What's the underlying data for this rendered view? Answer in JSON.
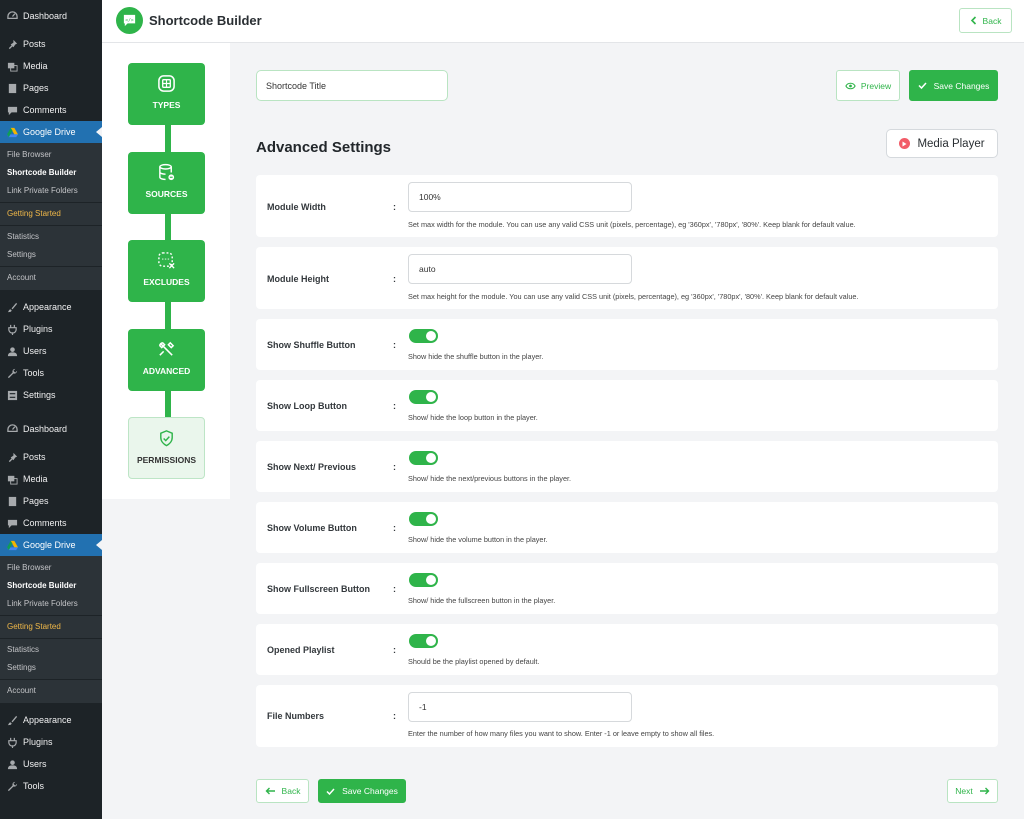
{
  "sidebar": {
    "groups": [
      {
        "items": [
          {
            "label": "Dashboard",
            "icon": "dashboard-icon"
          },
          {
            "label": "Posts",
            "icon": "pin-icon"
          },
          {
            "label": "Media",
            "icon": "media-icon"
          },
          {
            "label": "Pages",
            "icon": "pages-icon"
          },
          {
            "label": "Comments",
            "icon": "comments-icon"
          },
          {
            "label": "Google Drive",
            "icon": "google-drive-icon",
            "active": true
          }
        ],
        "submenu": [
          "File Browser",
          "Shortcode Builder",
          "Link Private Folders",
          "Getting Started",
          "Statistics",
          "Settings",
          "Account"
        ],
        "after": [
          "Appearance",
          "Plugins",
          "Users",
          "Tools",
          "Settings"
        ]
      },
      {
        "items": [
          {
            "label": "Dashboard"
          },
          {
            "label": "Posts"
          },
          {
            "label": "Media"
          },
          {
            "label": "Pages"
          },
          {
            "label": "Comments"
          },
          {
            "label": "Google Drive"
          }
        ],
        "submenu": [
          "File Browser",
          "Shortcode Builder",
          "Link Private Folders",
          "Getting Started",
          "Statistics",
          "Settings",
          "Account"
        ],
        "after": [
          "Appearance",
          "Plugins",
          "Users",
          "Tools"
        ]
      }
    ]
  },
  "header": {
    "title": "Shortcode Builder",
    "back_label": "Back"
  },
  "steps": [
    {
      "label": "TYPES",
      "icon": "grid-plus-icon",
      "state": "complete"
    },
    {
      "label": "SOURCES",
      "icon": "database-icon",
      "state": "complete"
    },
    {
      "label": "EXCLUDES",
      "icon": "exclude-icon",
      "state": "complete"
    },
    {
      "label": "ADVANCED",
      "icon": "tools-icon",
      "state": "active"
    },
    {
      "label": "PERMISSIONS",
      "icon": "shield-check-icon",
      "state": "pending"
    }
  ],
  "main": {
    "title_input_value": "Shortcode Title",
    "preview_label": "Preview",
    "save_label": "Save Changes",
    "section_title": "Advanced Settings",
    "type_badge": "Media Player",
    "settings": [
      {
        "label": "Module Width",
        "value": "100%",
        "desc": "Set max width for the module. You can use any valid CSS unit (pixels, percentage), eg '360px', '780px', '80%'. Keep blank for default value."
      },
      {
        "label": "Module Height",
        "value": "auto",
        "desc": "Set max height for the module. You can use any valid CSS unit (pixels, percentage), eg '360px', '780px', '80%'. Keep blank for default value."
      },
      {
        "label": "Show Shuffle Button",
        "on": true,
        "desc": "Show hide the shuffle button in the player."
      },
      {
        "label": "Show Loop Button",
        "on": true,
        "desc": "Show/ hide the loop button in the player."
      },
      {
        "label": "Show Next/ Previous",
        "on": true,
        "desc": "Show/ hide the next/previous buttons in the player."
      },
      {
        "label": "Show Volume Button",
        "on": true,
        "desc": "Show/ hide the volume button in the player."
      },
      {
        "label": "Show Fullscreen Button",
        "on": true,
        "desc": "Show/ hide the fullscreen button in the player."
      },
      {
        "label": "Opened Playlist",
        "on": true,
        "desc": "Should be the playlist opened by default."
      },
      {
        "label": "File Numbers",
        "value": "-1",
        "desc": "Enter the number of how many files you want to show. Enter -1 or leave empty to show all files."
      }
    ],
    "colon": ":"
  },
  "footer": {
    "back_label": "Back",
    "save_label": "Save Changes",
    "next_label": "Next"
  },
  "colors": {
    "accent": "#2fb44a",
    "sidebar_bg": "#1d2327",
    "active_menu": "#2271b1",
    "getting_started": "#f0b849"
  }
}
